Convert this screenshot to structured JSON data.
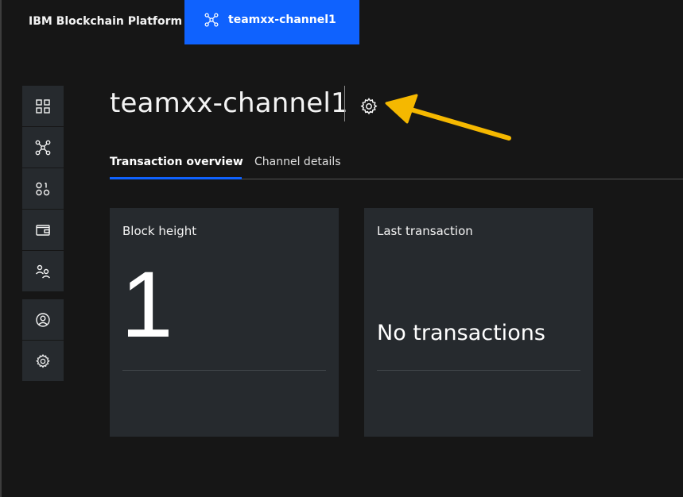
{
  "header": {
    "brand": "IBM Blockchain Platform",
    "active_tab": {
      "label": "teamxx-channel1",
      "icon": "channel-icon"
    }
  },
  "sidebar": {
    "items": [
      {
        "icon": "nodes-grid-icon"
      },
      {
        "icon": "channels-icon"
      },
      {
        "icon": "smart-contracts-icon"
      },
      {
        "icon": "wallet-icon"
      },
      {
        "icon": "organizations-icon"
      },
      {
        "icon": "user-profile-icon"
      },
      {
        "icon": "settings-gear-icon"
      }
    ]
  },
  "main": {
    "title": "teamxx-channel1",
    "title_icon": "gear-icon",
    "tabs": [
      {
        "label": "Transaction overview",
        "active": true
      },
      {
        "label": "Channel details",
        "active": false
      }
    ],
    "tiles": [
      {
        "label": "Block height",
        "value": "1"
      },
      {
        "label": "Last transaction",
        "value": "No transactions"
      }
    ]
  },
  "colors": {
    "accent": "#0f62fe",
    "background": "#161616",
    "tile": "#262a2e",
    "annotation_arrow": "#f5b800"
  }
}
